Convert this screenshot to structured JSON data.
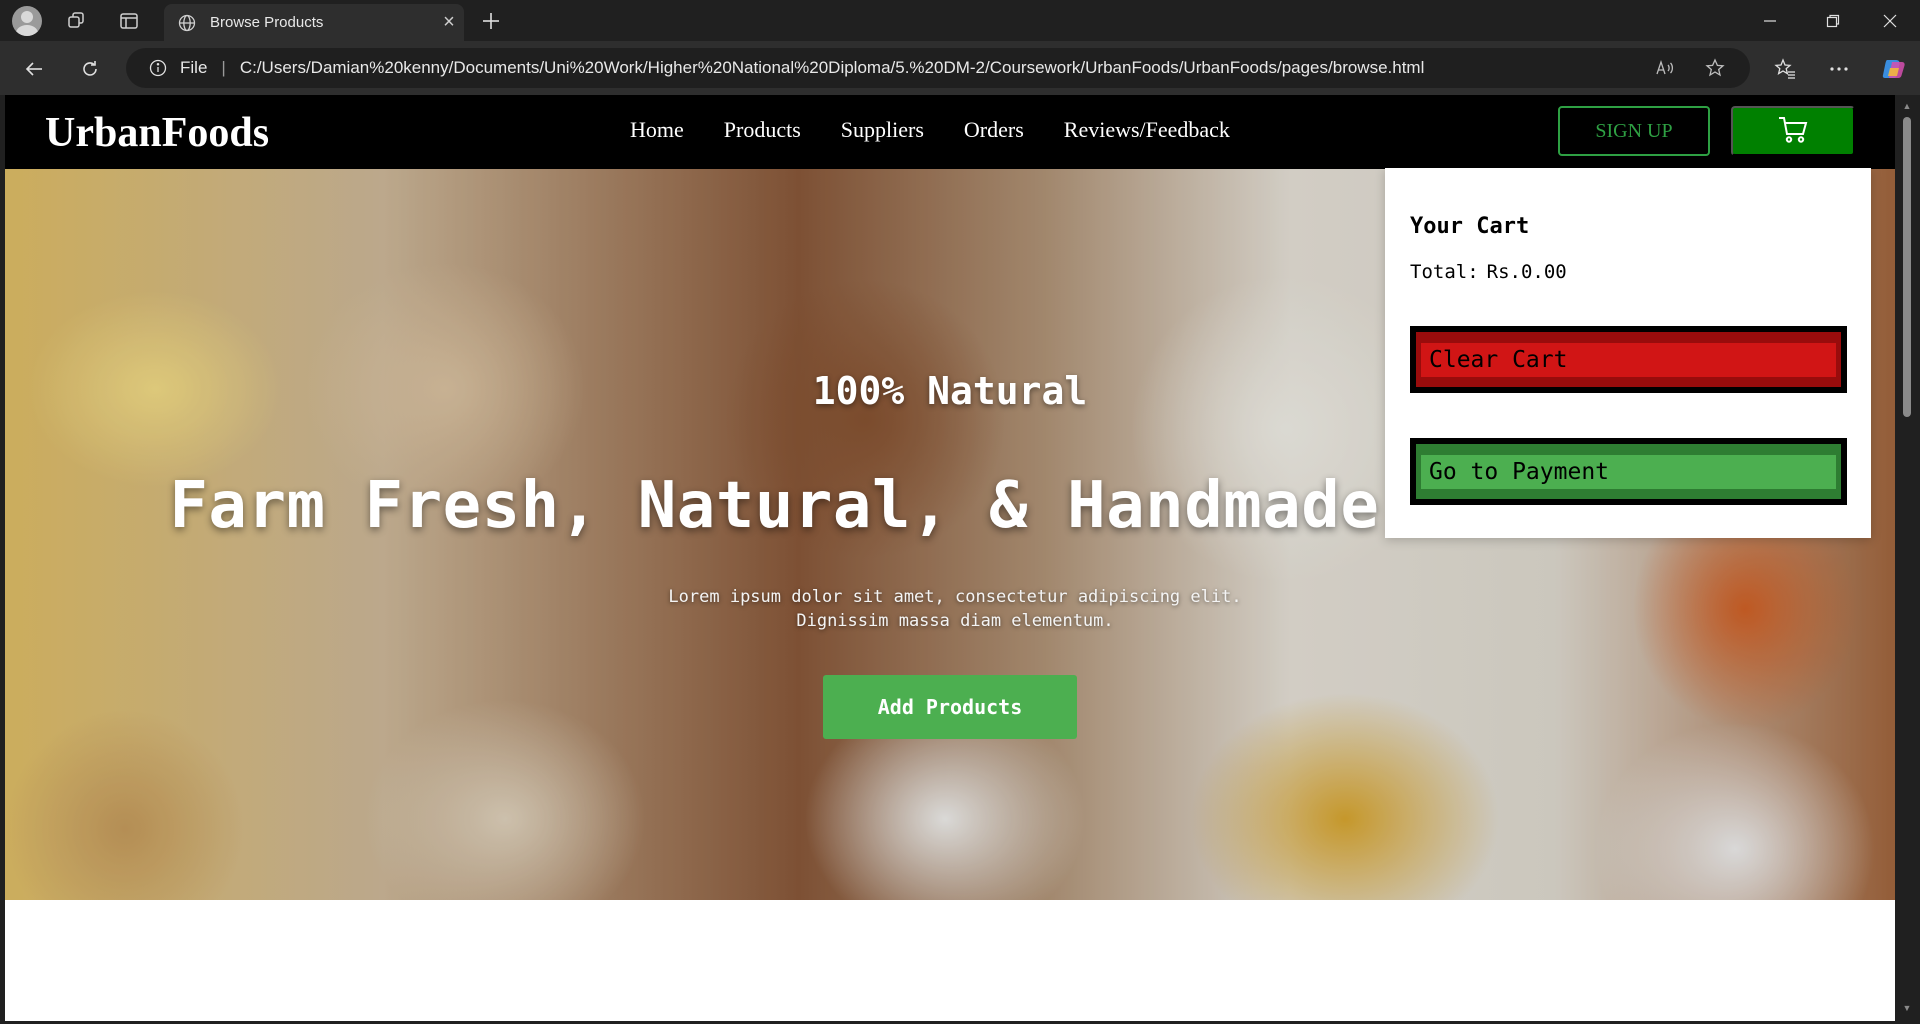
{
  "browser": {
    "tab_title": "Browse Products",
    "address_scheme": "File",
    "address_url": "C:/Users/Damian%20kenny/Documents/Uni%20Work/Higher%20National%20Diploma/5.%20DM-2/Coursework/UrbanFoods/UrbanFoods/pages/browse.html"
  },
  "site": {
    "logo": "UrbanFoods",
    "nav": [
      "Home",
      "Products",
      "Suppliers",
      "Orders",
      "Reviews/Feedback"
    ],
    "signup_label": "SIGN UP"
  },
  "hero": {
    "kicker": "100% Natural",
    "title": "Farm Fresh, Natural, & Handmade Products",
    "subtitle_line1": "Lorem ipsum dolor sit amet, consectetur adipiscing elit.",
    "subtitle_line2": "Dignissim massa diam elementum.",
    "cta_label": "Add Products"
  },
  "cart": {
    "title": "Your Cart",
    "total_label": "Total:",
    "total_value": "Rs.0.00",
    "clear_label": "Clear Cart",
    "payment_label": "Go to Payment"
  },
  "colors": {
    "header_bg": "#000000",
    "brand_green": "#008000",
    "cta_green": "#4caf50",
    "clear_red": "#d11515"
  }
}
